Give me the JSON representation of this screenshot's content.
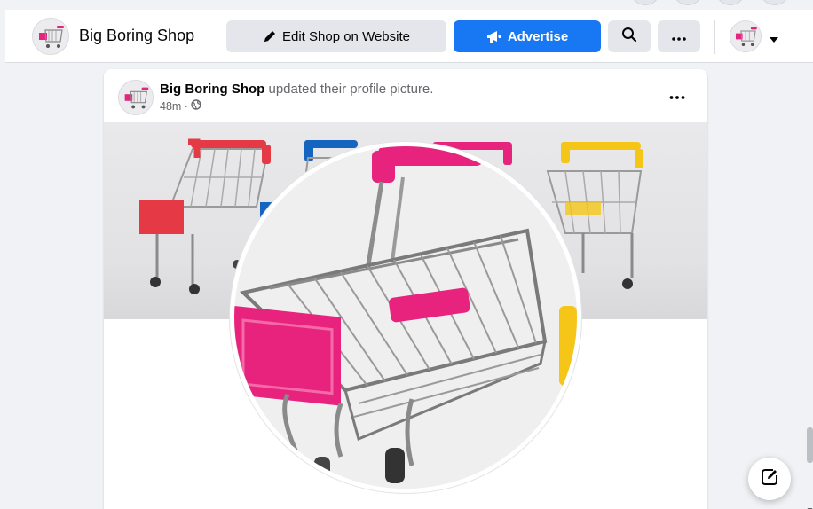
{
  "header": {
    "shop_name": "Big Boring Shop",
    "edit_label": "Edit Shop on Website",
    "advertise_label": "Advertise",
    "icons": {
      "edit": "pencil-icon",
      "advertise": "megaphone-icon",
      "search": "search-icon",
      "more": "more-dots-icon",
      "account": "chevron-down-icon"
    }
  },
  "post": {
    "author": "Big Boring Shop",
    "action": " updated their profile picture.",
    "time": "48m · ",
    "privacy_icon": "globe-icon",
    "more_icon": "more-dots-icon"
  },
  "fab": {
    "icon": "compose-icon"
  },
  "colors": {
    "accent": "#1877f2",
    "button_gray": "#e4e6eb",
    "page_bg": "#f0f2f5",
    "cart_pink": "#e8237e",
    "cart_red": "#e63946",
    "cart_blue": "#1565c0",
    "cart_yellow": "#f5c518"
  }
}
